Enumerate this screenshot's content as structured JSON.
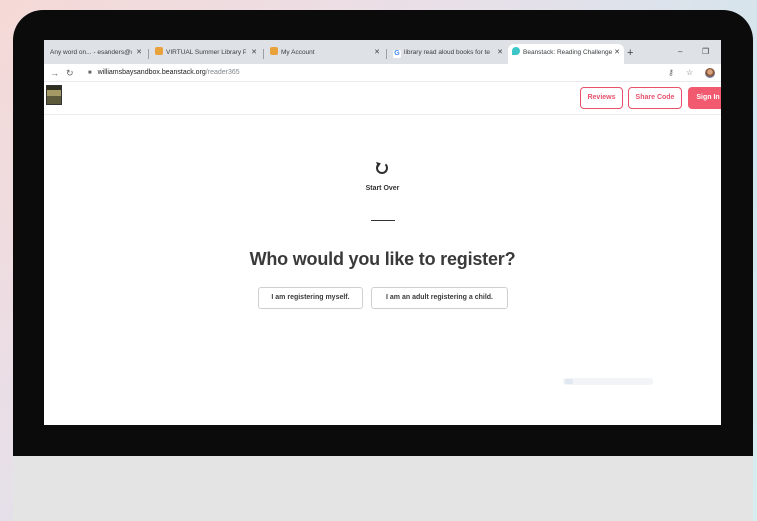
{
  "browser": {
    "tabs": [
      {
        "title": "Any word on... - esanders@wi",
        "favicon_color": "#c5221f",
        "active": false
      },
      {
        "title": "VIRTUAL Summer Library Prog",
        "favicon_color": "#e9a23b",
        "active": false
      },
      {
        "title": "My Account",
        "favicon_color": "#e9a23b",
        "active": false
      },
      {
        "title": "library read aloud books for te",
        "favicon_color": "#4285f4",
        "active": false
      },
      {
        "title": "Beanstack: Reading Challenge",
        "favicon_color": "#3ec6c9",
        "active": true
      }
    ],
    "new_tab": "+",
    "address": {
      "host": "williamsbaysandbox.beanstack.org",
      "path": "/reader365"
    }
  },
  "site": {
    "header": {
      "reviews": "Reviews",
      "share_code": "Share Code",
      "sign_in": "Sign In"
    },
    "main": {
      "start_over": "Start Over",
      "headline": "Who would you like to register?",
      "choice_self": "I am registering myself.",
      "choice_child": "I am an adult registering a child."
    }
  },
  "colors": {
    "accent": "#f25a6f",
    "tab_strip": "#dee1e6",
    "bezel": "#0b0b0b"
  }
}
